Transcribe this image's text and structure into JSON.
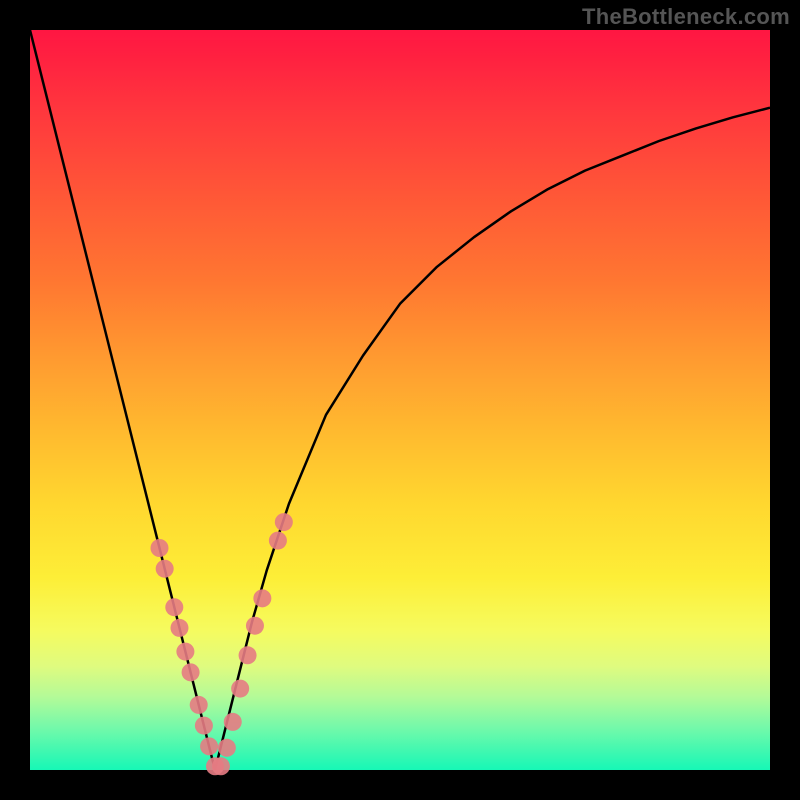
{
  "watermark": "TheBottleneck.com",
  "colors": {
    "curve_stroke": "#000000",
    "marker_fill": "#e57b83",
    "marker_fill_alpha": 0.9
  },
  "chart_data": {
    "type": "line",
    "title": "",
    "xlabel": "",
    "ylabel": "",
    "xlim": [
      0,
      100
    ],
    "ylim": [
      0,
      100
    ],
    "x_min_pct": 25,
    "curve": {
      "x": [
        0,
        2,
        4,
        6,
        8,
        10,
        12,
        14,
        16,
        18,
        20,
        22,
        24,
        25,
        26,
        27,
        28,
        30,
        32,
        35,
        40,
        45,
        50,
        55,
        60,
        65,
        70,
        75,
        80,
        85,
        90,
        95,
        100
      ],
      "y": [
        100,
        92,
        84,
        76,
        68,
        60,
        52,
        44,
        36,
        28,
        20,
        12,
        4,
        0,
        4,
        8,
        12,
        20,
        27,
        36,
        48,
        56,
        63,
        68,
        72,
        75.5,
        78.5,
        81,
        83,
        85,
        86.7,
        88.2,
        89.5
      ]
    },
    "markers": [
      {
        "x": 17.5,
        "y": 30.0
      },
      {
        "x": 18.2,
        "y": 27.2
      },
      {
        "x": 19.5,
        "y": 22.0
      },
      {
        "x": 20.2,
        "y": 19.2
      },
      {
        "x": 21.0,
        "y": 16.0
      },
      {
        "x": 21.7,
        "y": 13.2
      },
      {
        "x": 22.8,
        "y": 8.8
      },
      {
        "x": 23.5,
        "y": 6.0
      },
      {
        "x": 24.2,
        "y": 3.2
      },
      {
        "x": 25.0,
        "y": 0.5
      },
      {
        "x": 25.8,
        "y": 0.5
      },
      {
        "x": 26.6,
        "y": 3.0
      },
      {
        "x": 27.4,
        "y": 6.5
      },
      {
        "x": 28.4,
        "y": 11.0
      },
      {
        "x": 29.4,
        "y": 15.5
      },
      {
        "x": 30.4,
        "y": 19.5
      },
      {
        "x": 31.4,
        "y": 23.2
      },
      {
        "x": 33.5,
        "y": 31.0
      },
      {
        "x": 34.3,
        "y": 33.5
      }
    ]
  }
}
